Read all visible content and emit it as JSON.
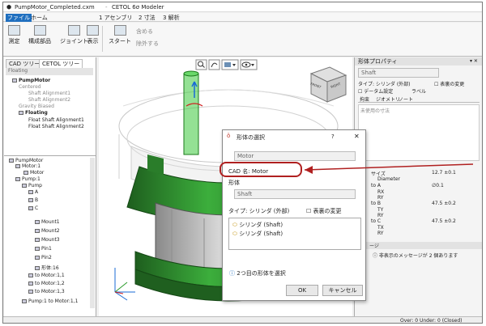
{
  "title_bar": {
    "file_title": "PumpMotor_Completed.cxm",
    "app_title": "CETOL 6σ Modeler"
  },
  "menu": {
    "items": [
      "ファイル",
      "ホーム",
      "1 アセンブリ",
      "2 寸法",
      "3 解析"
    ]
  },
  "ribbon": {
    "buttons": [
      "測定",
      "構成部品",
      "ジョイント",
      "表示",
      "スタート"
    ],
    "side_items": [
      "含める",
      "除外する"
    ]
  },
  "left_panel": {
    "tabs": [
      "CAD ツリー",
      "CETOL ツリー"
    ],
    "top_header": "Floating",
    "top_tree": [
      {
        "label": "PumpMotor",
        "bold": true
      },
      {
        "label": "Centered",
        "bold": false,
        "gray": true
      },
      {
        "label": "Shaft Alignment1",
        "gray": true
      },
      {
        "label": "Shaft Alignment2",
        "gray": true
      },
      {
        "label": "Gravity Biased",
        "gray": true
      },
      {
        "label": "Floating",
        "bold": true
      },
      {
        "label": "Float Shaft Alignment1"
      },
      {
        "label": "Float Shaft Alignment2"
      }
    ],
    "bottom_tree": [
      {
        "label": "PumpMotor"
      },
      {
        "label": "Motor:1"
      },
      {
        "label": "Motor"
      },
      {
        "label": "Pump:1"
      },
      {
        "label": "Pump"
      },
      {
        "label": "A"
      },
      {
        "label": "B"
      },
      {
        "label": "C"
      },
      {
        "label": "Mount1"
      },
      {
        "label": "Mount2"
      },
      {
        "label": "Mount3"
      },
      {
        "label": "Pin1"
      },
      {
        "label": "Pin2"
      },
      {
        "label": "形体:16"
      },
      {
        "label": "to Motor:1,1"
      },
      {
        "label": "to Motor:1,2"
      },
      {
        "label": "to Motor:1,3"
      },
      {
        "label": "Pump:1 to Motor:1,1"
      }
    ]
  },
  "view_cube": {
    "front": "FRONT",
    "right": "RIGHT"
  },
  "dialog": {
    "title": "形体の選択",
    "help": "?",
    "part_value": "Motor",
    "cad_name_label": "CAD 名:",
    "cad_name_value": "Motor",
    "feature_label": "形体",
    "feature_value": "Shaft",
    "type_label": "タイプ: シリンダ (外部)",
    "change_label": "表裏の変更",
    "list_items": [
      "シリンダ (Shaft)",
      "シリンダ (Shaft)"
    ],
    "info_text": "2つ目の形体を選択",
    "ok_label": "OK",
    "cancel_label": "キャンセル"
  },
  "right_panel": {
    "header": "形体プロパティ",
    "name_value": "Shaft",
    "type_label": "タイプ: シリンダ (外部)",
    "change_label": "表裏の変更",
    "datum_label": "データム設定",
    "label_label": "ラベル",
    "tabs": [
      "拘束",
      "ジオメトリ",
      "ノート"
    ],
    "unused_label": "未使用の寸法",
    "rows": [
      {
        "label": "サイズ",
        "value": "12.7 ±0.1"
      },
      {
        "label": "Diameter",
        "value": ""
      },
      {
        "label": "to A",
        "value": "∅0.1"
      },
      {
        "label": "RX",
        "value": ""
      },
      {
        "label": "RY",
        "value": ""
      },
      {
        "label": "to B",
        "value": "47.5 ±0.2"
      },
      {
        "label": "TY",
        "value": ""
      },
      {
        "label": "RY",
        "value": ""
      },
      {
        "label": "to C",
        "value": "47.5 ±0.2"
      },
      {
        "label": "TX",
        "value": ""
      },
      {
        "label": "RY",
        "value": ""
      }
    ],
    "messages_header": "ージ",
    "messages_text": "非表示のメッセージが 2 個あります"
  },
  "status": {
    "text": "Over: 0 Under: 0 (Closed)"
  },
  "colors": {
    "callout": "#b02020",
    "accent": "#1f6fbf",
    "green": "#2e8b2e"
  }
}
